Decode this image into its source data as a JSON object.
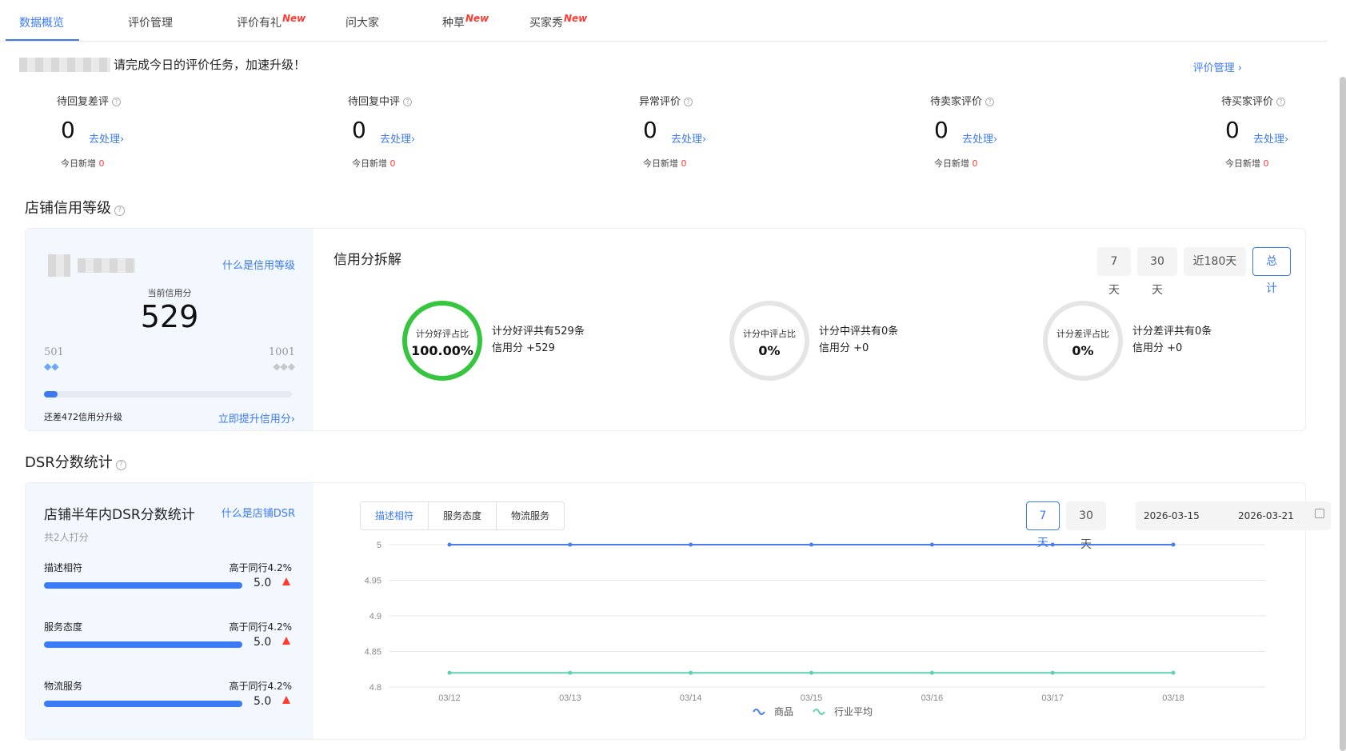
{
  "tabs": [
    {
      "label": "数据概览",
      "new": ""
    },
    {
      "label": "评价管理",
      "new": ""
    },
    {
      "label": "评价有礼",
      "new": "New"
    },
    {
      "label": "问大家",
      "new": ""
    },
    {
      "label": "种草",
      "new": "New"
    },
    {
      "label": "买家秀",
      "new": "New"
    }
  ],
  "notice": {
    "text": "请完成今日的评价任务，加速升级！",
    "link": "评价管理 ›"
  },
  "pending": [
    {
      "label": "待回复差评",
      "value": "0",
      "action": "去处理›",
      "today_label": "今日新增",
      "today_value": "0"
    },
    {
      "label": "待回复中评",
      "value": "0",
      "action": "去处理›",
      "today_label": "今日新增",
      "today_value": "0"
    },
    {
      "label": "异常评价",
      "value": "0",
      "action": "去处理›",
      "today_label": "今日新增",
      "today_value": "0"
    },
    {
      "label": "待卖家评价",
      "value": "0",
      "action": "去处理›",
      "today_label": "今日新增",
      "today_value": "0"
    },
    {
      "label": "待买家评价",
      "value": "0",
      "action": "去处理›",
      "today_label": "今日新增",
      "today_value": "0"
    }
  ],
  "credit": {
    "section_title": "店铺信用等级",
    "what_link": "什么是信用等级",
    "current_label": "当前信用分",
    "score": "529",
    "min": "501",
    "max": "1001",
    "progress_fraction": 0.056,
    "remaining_text": "还差472信用分升级",
    "improve_link": "立即提升信用分›",
    "breakdown_title": "信用分拆解",
    "ranges": [
      "7天",
      "30天",
      "近180天",
      "总计"
    ],
    "active_range": "总计",
    "rings": [
      {
        "title": "计分好评占比",
        "value": "100.00%",
        "line1": "计分好评共有529条",
        "line2": "信用分 +529",
        "fraction": 1.0
      },
      {
        "title": "计分中评占比",
        "value": "0%",
        "line1": "计分中评共有0条",
        "line2": "信用分 +0",
        "fraction": 0
      },
      {
        "title": "计分差评占比",
        "value": "0%",
        "line1": "计分差评共有0条",
        "line2": "信用分 +0",
        "fraction": 0
      }
    ]
  },
  "dsr": {
    "section_title": "DSR分数统计",
    "card_title": "店铺半年内DSR分数统计",
    "what_link": "什么是店铺DSR",
    "raters": "共2人打分",
    "items": [
      {
        "name": "描述相符",
        "compare": "高于同行4.2%",
        "score": "5.0"
      },
      {
        "name": "服务态度",
        "compare": "高于同行4.2%",
        "score": "5.0"
      },
      {
        "name": "物流服务",
        "compare": "高于同行4.2%",
        "score": "5.0"
      }
    ],
    "metric_tabs": [
      "描述相符",
      "服务态度",
      "物流服务"
    ],
    "active_metric": "描述相符",
    "ranges": [
      "7天",
      "30天"
    ],
    "active_range": "7天",
    "date_start": "2026-03-15",
    "date_end": "2026-03-21"
  },
  "chart_data": {
    "type": "line",
    "x": [
      "03/12",
      "03/13",
      "03/14",
      "03/15",
      "03/16",
      "03/17",
      "03/18"
    ],
    "ylim": [
      4.8,
      5
    ],
    "yticks": [
      "5",
      "4.95",
      "4.9",
      "4.85",
      "4.8"
    ],
    "series": [
      {
        "name": "商品",
        "color": "#4a7cf0",
        "values": [
          5,
          5,
          5,
          5,
          5,
          5,
          5
        ]
      },
      {
        "name": "行业平均",
        "color": "#5ed1b1",
        "values": [
          4.82,
          4.82,
          4.82,
          4.82,
          4.82,
          4.82,
          4.82
        ]
      }
    ],
    "grid": true,
    "legend": "bottom"
  }
}
